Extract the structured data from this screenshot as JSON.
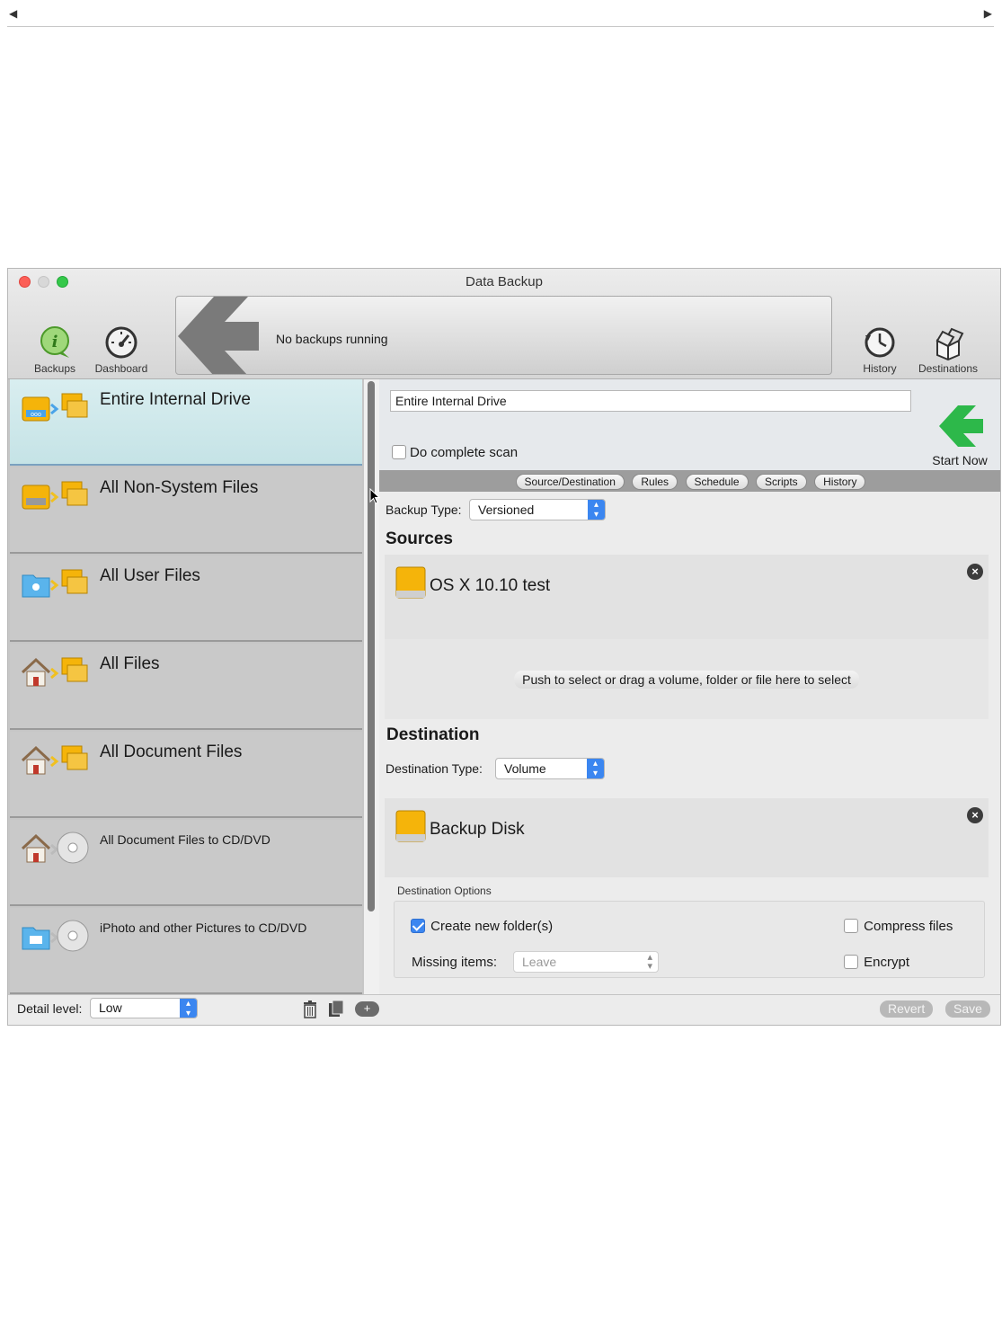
{
  "window": {
    "title": "Data Backup"
  },
  "toolbar": {
    "backups_label": "Backups",
    "dashboard_label": "Dashboard",
    "status_text": "No backups running",
    "history_label": "History",
    "destinations_label": "Destinations"
  },
  "backup_list": [
    {
      "label": "Entire Internal Drive",
      "icon": "drive-to-drive-icon",
      "selected": true
    },
    {
      "label": "All Non-System Files",
      "icon": "drive-to-drive-icon",
      "selected": false
    },
    {
      "label": "All User Files",
      "icon": "user-folder-to-drive-icon",
      "selected": false
    },
    {
      "label": "All Files",
      "icon": "home-to-drive-icon",
      "selected": false
    },
    {
      "label": "All Document Files",
      "icon": "home-to-drive-icon",
      "selected": false
    },
    {
      "label": "All Document Files to CD/DVD",
      "icon": "home-to-disc-icon",
      "selected": false
    },
    {
      "label": "iPhoto and other Pictures to CD/DVD",
      "icon": "photo-folder-to-disc-icon",
      "selected": false
    }
  ],
  "detail": {
    "name_value": "Entire Internal Drive",
    "complete_scan_label": "Do complete scan",
    "complete_scan_checked": false,
    "start_now_label": "Start Now"
  },
  "tabs": [
    "Source/Destination",
    "Rules",
    "Schedule",
    "Scripts",
    "History"
  ],
  "source_dest": {
    "backup_type_label": "Backup Type:",
    "backup_type_value": "Versioned",
    "sources_heading": "Sources",
    "source_item": "OS X 10.10 test",
    "drop_hint": "Push to select or drag a volume, folder or file here to select",
    "destination_heading": "Destination",
    "destination_type_label": "Destination Type:",
    "destination_type_value": "Volume",
    "destination_item": "Backup Disk",
    "options_title": "Destination Options",
    "create_folder_label": "Create new folder(s)",
    "create_folder_checked": true,
    "compress_label": "Compress files",
    "compress_checked": false,
    "encrypt_label": "Encrypt",
    "encrypt_checked": false,
    "missing_items_label": "Missing items:",
    "missing_items_value": "Leave"
  },
  "bottom": {
    "detail_level_label": "Detail level:",
    "detail_level_value": "Low",
    "revert_label": "Revert",
    "save_label": "Save"
  },
  "colors": {
    "accent": "#3b86f0",
    "start_green": "#2db84a",
    "selected_row": "#cfe8eb",
    "orange_drive": "#f5b40a"
  }
}
